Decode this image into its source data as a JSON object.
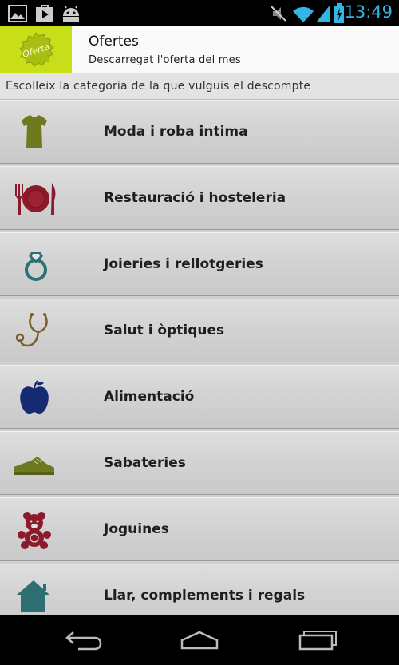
{
  "status_bar": {
    "time": "13:49",
    "icons": [
      "image-notification-icon",
      "play-store-notification-icon",
      "android-notification-icon",
      "mute-icon",
      "wifi-icon",
      "signal-icon",
      "battery-charging-icon"
    ],
    "accent_color": "#33b5e5"
  },
  "banner": {
    "logo_text": "Oferta",
    "title": "Ofertes",
    "subtitle": "Descarregat l'oferta del mes",
    "logo_color": "#c8de18"
  },
  "prompt": "Escolleix la categoria de la que vulguis el descompte",
  "categories": [
    {
      "label": "Moda i roba intima",
      "icon": "tshirt-icon"
    },
    {
      "label": "Restauració i hosteleria",
      "icon": "plate-cutlery-icon"
    },
    {
      "label": "Joieries i rellotgeries",
      "icon": "ring-icon"
    },
    {
      "label": "Salut i òptiques",
      "icon": "stethoscope-icon"
    },
    {
      "label": "Alimentació",
      "icon": "apple-icon"
    },
    {
      "label": "Sabateries",
      "icon": "shoe-icon"
    },
    {
      "label": "Joguines",
      "icon": "teddy-bear-icon"
    },
    {
      "label": "Llar, complements i regals",
      "icon": "house-icon"
    }
  ],
  "nav_bar": {
    "buttons": [
      "back-icon",
      "home-icon",
      "recent-apps-icon"
    ]
  }
}
